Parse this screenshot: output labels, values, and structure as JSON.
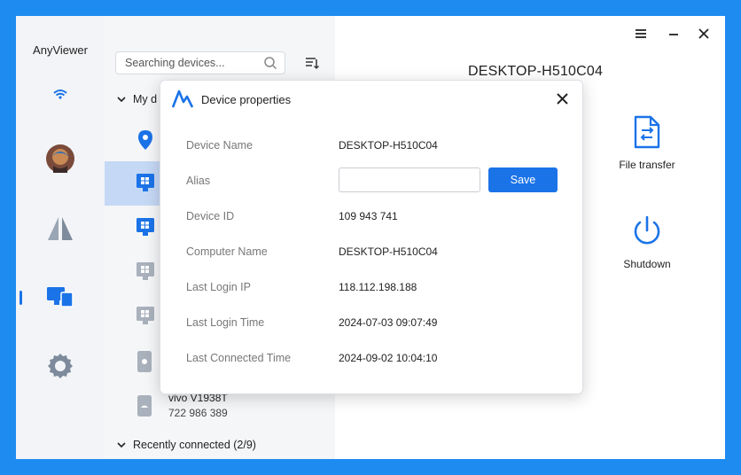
{
  "app": {
    "title": "AnyViewer"
  },
  "window_controls": {
    "menu_icon": "hamburger-icon",
    "minimize_icon": "minimize-icon",
    "close_icon": "close-icon"
  },
  "rail": {
    "items": [
      {
        "name": "wifi",
        "icon": "wifi-icon"
      },
      {
        "name": "avatar",
        "icon": "avatar-image"
      },
      {
        "name": "remote-control",
        "icon": "triangles-icon"
      },
      {
        "name": "devices",
        "icon": "monitors-icon",
        "active": true
      },
      {
        "name": "settings",
        "icon": "gear-icon"
      }
    ]
  },
  "search": {
    "placeholder": "Searching devices..."
  },
  "device_list": {
    "my_devices_label": "My d",
    "visible_device": {
      "name": "vivo V1938T",
      "id": "722 986 389"
    },
    "recent_label": "Recently connected (2/9)"
  },
  "main": {
    "device_title": "DESKTOP-H510C04",
    "actions": [
      {
        "label": "File transfer",
        "icon": "file-transfer-icon"
      },
      {
        "label": "Shutdown",
        "icon": "power-icon"
      }
    ]
  },
  "dialog": {
    "title": "Device properties",
    "save_label": "Save",
    "alias_value": "",
    "properties": {
      "device_name_label": "Device Name",
      "device_name": "DESKTOP-H510C04",
      "alias_label": "Alias",
      "device_id_label": "Device ID",
      "device_id": "109 943 741",
      "computer_name_label": "Computer Name",
      "computer_name": "DESKTOP-H510C04",
      "last_login_ip_label": "Last Login IP",
      "last_login_ip": "118.112.198.188",
      "last_login_time_label": "Last Login Time",
      "last_login_time": "2024-07-03 09:07:49",
      "last_connected_time_label": "Last Connected Time",
      "last_connected_time": "2024-09-02 10:04:10"
    }
  },
  "colors": {
    "accent": "#1b73e8",
    "background": "#1e8bf0",
    "rail": "#f2f4f7",
    "selected_row": "#c5d8f5"
  }
}
